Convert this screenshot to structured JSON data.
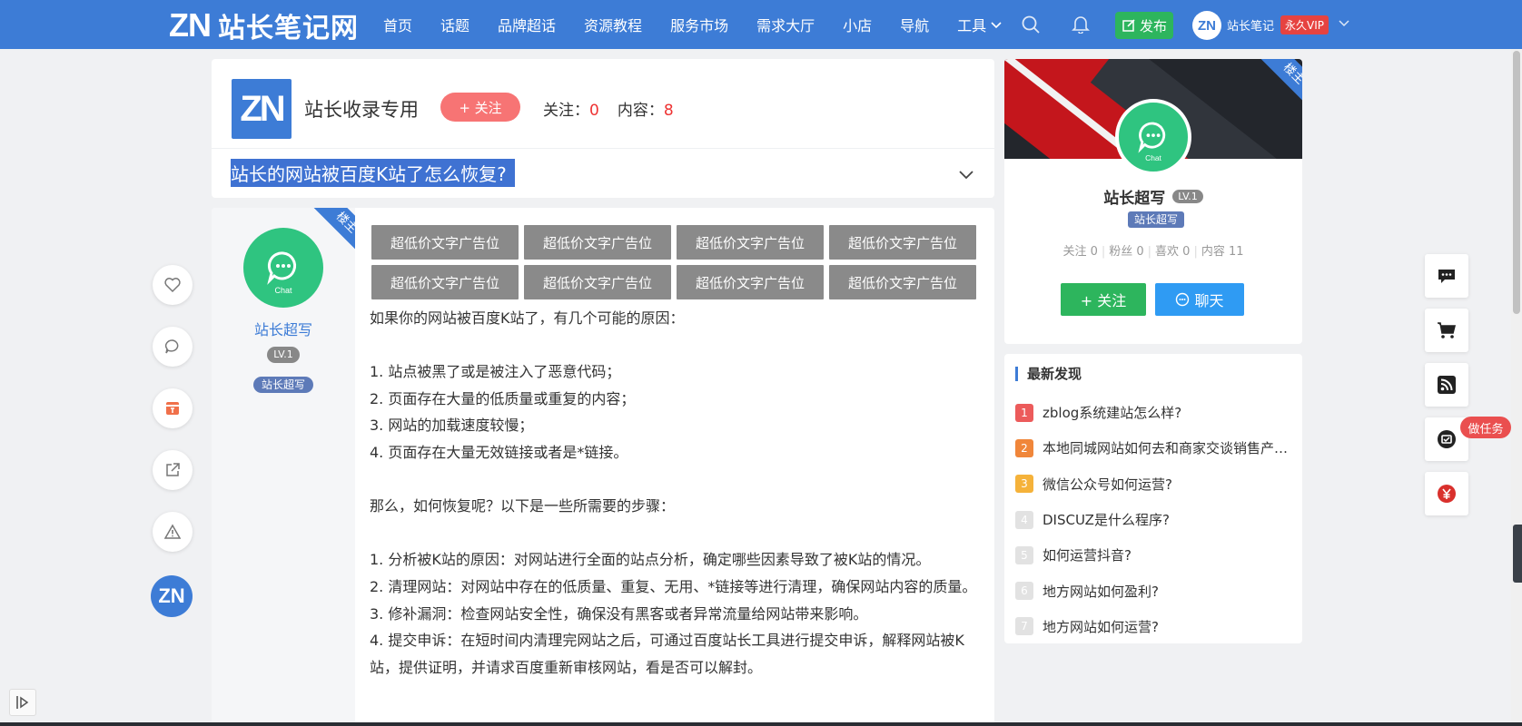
{
  "site": {
    "logo_mark": "ZN",
    "logo_name": "站长笔记网"
  },
  "nav": {
    "links": [
      "首页",
      "话题",
      "品牌超话",
      "资源教程",
      "服务市场",
      "需求大厅",
      "小店",
      "导航",
      "工具"
    ],
    "publish_label": "发布",
    "avatar_text": "ZN",
    "username": "站长笔记",
    "vip_label": "永久VIP"
  },
  "category": {
    "logo_text": "ZN",
    "title": "站长收录专用",
    "follow_label": "+ 关注",
    "followers_label": "关注：",
    "followers": "0",
    "content_label": "内容：",
    "content": "8"
  },
  "question": {
    "title": "站长的网站被百度K站了怎么恢复?"
  },
  "post": {
    "owner_tag": "楼主",
    "author_name": "站长超写",
    "level": "LV.1",
    "role": "站长超写",
    "ads": [
      "超低价文字广告位",
      "超低价文字广告位",
      "超低价文字广告位",
      "超低价文字广告位",
      "超低价文字广告位",
      "超低价文字广告位",
      "超低价文字广告位",
      "超低价文字广告位"
    ],
    "paragraphs": [
      "如果你的网站被百度K站了，有几个可能的原因：",
      "",
      "1. 站点被黑了或是被注入了恶意代码；",
      "2. 页面存在大量的低质量或重复的内容；",
      "3. 网站的加载速度较慢；",
      "4. 页面存在大量无效链接或者是*链接。",
      "",
      "那么，如何恢复呢？以下是一些所需要的步骤：",
      "",
      "1. 分析被K站的原因：对网站进行全面的站点分析，确定哪些因素导致了被K站的情况。",
      "2. 清理网站：对网站中存在的低质量、重复、无用、*链接等进行清理，确保网站内容的质量。",
      "3. 修补漏洞：检查网站安全性，确保没有黑客或者异常流量给网站带来影响。",
      "4. 提交申诉：在短时间内清理完网站之后，可通过百度站长工具进行提交申诉，解释网站被K站，提供证明，并请求百度重新审核网站，看是否可以解封。"
    ]
  },
  "author_card": {
    "owner_tag": "楼主",
    "name": "站长超写",
    "level": "LV.1",
    "role": "站长超写",
    "stats": [
      "关注 0",
      "粉丝 0",
      "喜欢 0",
      "内容 11"
    ],
    "follow_label": "+ 关注",
    "chat_label": "聊天",
    "avatar_caption": "Chat"
  },
  "latest": {
    "title": "最新发现",
    "items": [
      {
        "rank": "1",
        "title": "zblog系统建站怎么样?"
      },
      {
        "rank": "2",
        "title": "本地同城网站如何去和商家交谈销售产品？"
      },
      {
        "rank": "3",
        "title": "微信公众号如何运营?"
      },
      {
        "rank": "4",
        "title": "DISCUZ是什么程序?"
      },
      {
        "rank": "5",
        "title": "如何运营抖音?"
      },
      {
        "rank": "6",
        "title": "地方网站如何盈利?"
      },
      {
        "rank": "7",
        "title": "地方网站如何运营?"
      }
    ],
    "rank_colors": [
      "#ec5b5b",
      "#f0863a",
      "#f5b23a",
      "#e2e2e2",
      "#e2e2e2",
      "#e2e2e2",
      "#e2e2e2"
    ]
  },
  "tools": {
    "task_label": "做任务"
  },
  "colors": {
    "brand": "#3d7cd6",
    "accent_green": "#2db55d",
    "accent_red": "#e33333",
    "chat_blue": "#2f9bf3"
  }
}
